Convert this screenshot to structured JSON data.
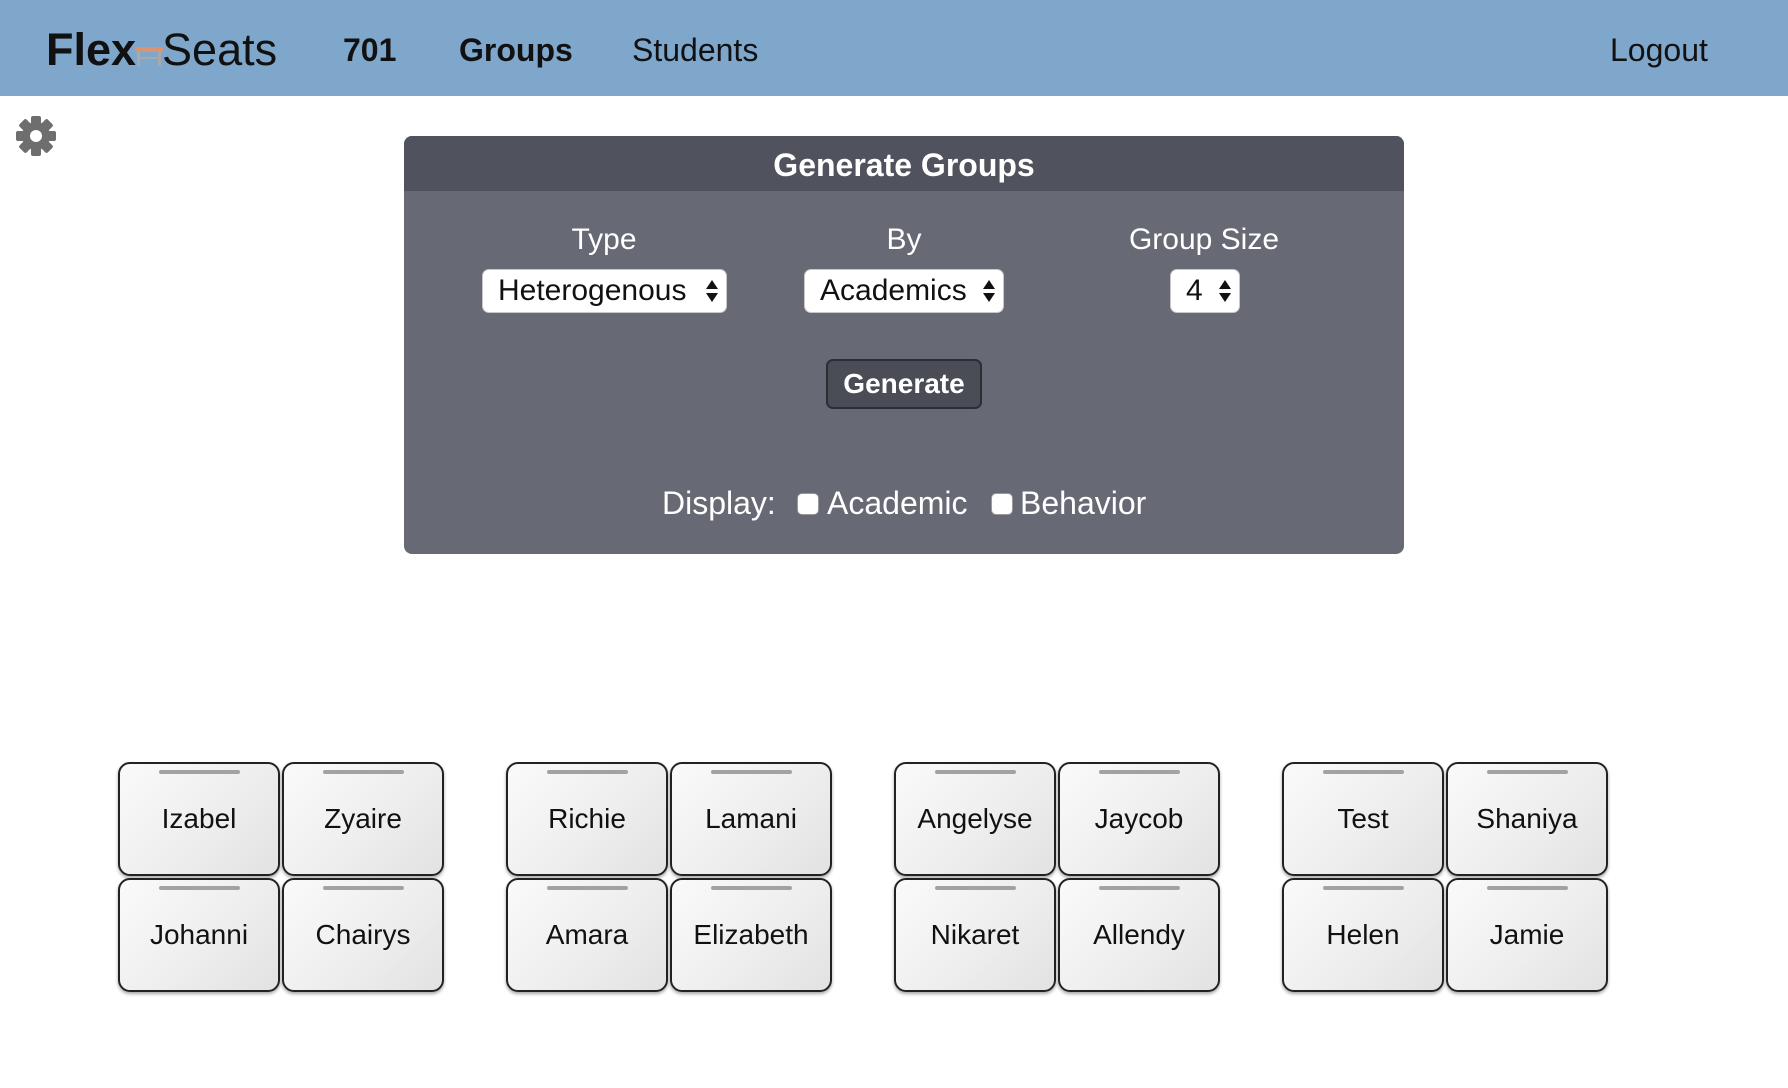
{
  "navbar": {
    "brand_part1": "Flex",
    "brand_icon": "chair-icon",
    "brand_part2": "Seats",
    "class_label": "701",
    "groups_label": "Groups",
    "students_label": "Students",
    "logout_label": "Logout",
    "background_color": "#7fa7cc"
  },
  "settings": {
    "icon": "gear-icon"
  },
  "panel": {
    "title": "Generate Groups",
    "type_label": "Type",
    "type_value": "Heterogenous",
    "by_label": "By",
    "by_value": "Academics",
    "group_size_label": "Group Size",
    "group_size_value": "4",
    "generate_label": "Generate",
    "display_label": "Display:",
    "academic_label": "Academic",
    "academic_checked": false,
    "behavior_label": "Behavior",
    "behavior_checked": false,
    "panel_color": "#676a74",
    "header_color": "#50535d"
  },
  "groups": [
    {
      "students": [
        "Izabel",
        "Zyaire",
        "Johanni",
        "Chairys"
      ]
    },
    {
      "students": [
        "Richie",
        "Lamani",
        "Amara",
        "Elizabeth"
      ]
    },
    {
      "students": [
        "Angelyse",
        "Jaycob",
        "Nikaret",
        "Allendy"
      ]
    },
    {
      "students": [
        "Test",
        "Shaniya",
        "Helen",
        "Jamie"
      ]
    }
  ]
}
